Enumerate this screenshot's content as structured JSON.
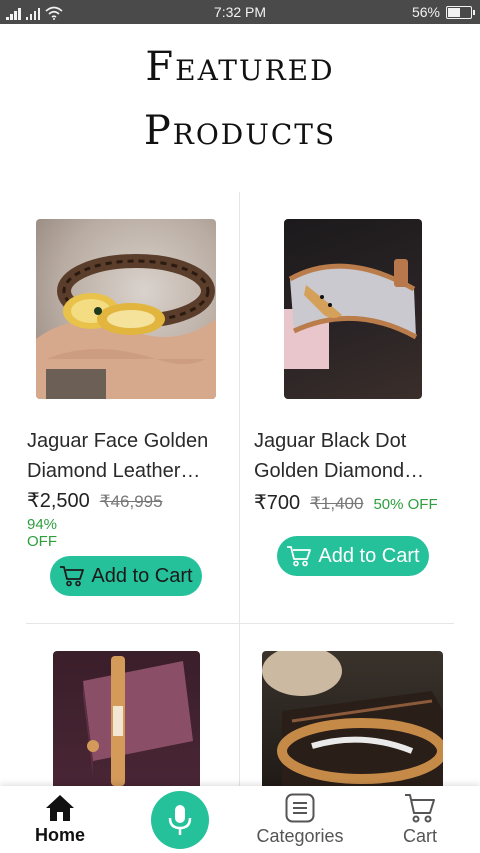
{
  "status_bar": {
    "time": "7:32 PM",
    "battery": "56%",
    "battery_level": 0.56
  },
  "page": {
    "title_line1": "Featured",
    "title_line2": "Products"
  },
  "products": [
    {
      "name_line1": "Jaguar Face Golden",
      "name_line2": "Diamond Leather…",
      "price": "₹2,500",
      "mrp": "₹46,995",
      "discount": "94% OFF",
      "cta": "Add to Cart"
    },
    {
      "name_line1": "Jaguar Black Dot",
      "name_line2": "Golden Diamond…",
      "price": "₹700",
      "mrp": "₹1,400",
      "discount": "50% OFF",
      "cta": "Add to Cart"
    }
  ],
  "bottom_nav": {
    "items": [
      {
        "label": "Home",
        "icon": "home-icon",
        "active": true
      },
      {
        "label": "",
        "icon": "mic-icon",
        "active": false
      },
      {
        "label": "Categories",
        "icon": "categories-icon",
        "active": false
      },
      {
        "label": "Cart",
        "icon": "cart-icon",
        "active": false
      }
    ]
  },
  "colors": {
    "accent": "#25c19a",
    "discount": "#2e9e3e",
    "status_bar": "#4a4a4a"
  }
}
